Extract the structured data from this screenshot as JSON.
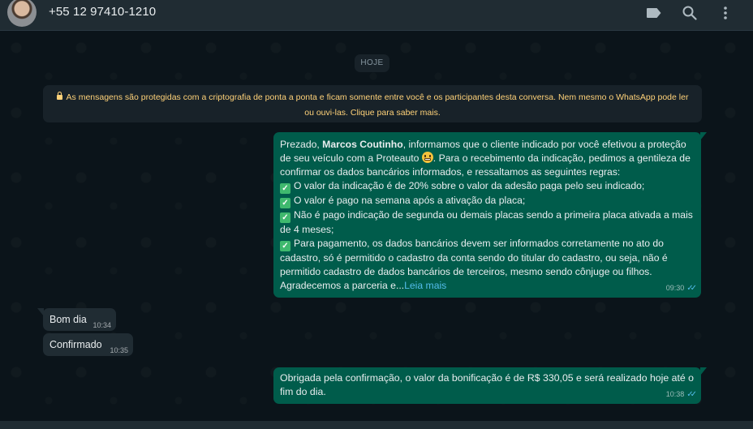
{
  "header": {
    "contact_name": "+55 12 97410-1210",
    "icons": [
      "label-icon",
      "search-icon",
      "menu-icon"
    ]
  },
  "chat": {
    "date_separator": "HOJE",
    "encryption_notice": "As mensagens são protegidas com a criptografia de ponta a ponta e ficam somente entre você e os participantes desta conversa. Nem mesmo o WhatsApp pode ler ou ouvi-las. Clique para saber mais.",
    "messages": [
      {
        "direction": "outgoing",
        "intro_prefix": "Prezado, ",
        "intro_bold": "Marcos Coutinho",
        "intro_after_bold": ", informamos que o cliente indicado por você efetivou a proteção de seu veículo com a Proteauto ",
        "intro_after_emoji": ". Para o recebimento da indicação, pedimos a gentileza de confirmar os dados bancários informados, e ressaltamos as seguintes regras:",
        "rules": [
          "O valor da indicação é de 20% sobre o valor da adesão paga pelo seu indicado;",
          "O valor é pago na semana após a ativação da placa;",
          "Não é pago indicação de segunda ou demais placas sendo a primeira placa ativada a mais de 4 meses;",
          "Para pagamento, os dados bancários devem ser informados corretamente no ato do cadastro, só é permitido o cadastro da conta sendo do titular do cadastro, ou seja, não é permitido cadastro de dados bancários de terceiros, mesmo sendo cônjuge ou filhos."
        ],
        "closing": "Agradecemos a parceria e...",
        "read_more": "Leia mais",
        "time": "09:30",
        "status": "read"
      },
      {
        "direction": "incoming",
        "text": "Bom dia",
        "time": "10:34"
      },
      {
        "direction": "incoming",
        "text": "Confirmado",
        "time": "10:35"
      },
      {
        "direction": "outgoing",
        "text": "Obrigada pela confirmação, o valor da bonificação é de R$ 330,05 e será realizado hoje até o fim do dia.",
        "time": "10:38",
        "status": "read"
      }
    ]
  },
  "colors": {
    "outgoing_bubble": "#005c4b",
    "incoming_bubble": "#202c33",
    "background": "#0b141a",
    "notice_text": "#ffd279",
    "link": "#53bdeb"
  }
}
